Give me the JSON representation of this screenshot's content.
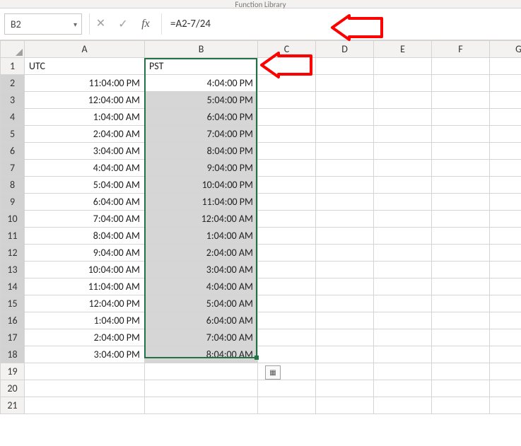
{
  "ribbon": {
    "group_label": "Function Library"
  },
  "namebox": {
    "value": "B2"
  },
  "formula": "=A2-7/24",
  "columns": [
    "A",
    "B",
    "C",
    "D",
    "E",
    "F",
    "G"
  ],
  "header": {
    "A": "UTC",
    "B": "PST"
  },
  "rows": [
    {
      "n": 2,
      "A": "11:04:00 PM",
      "B": "4:04:00 PM"
    },
    {
      "n": 3,
      "A": "12:04:00 AM",
      "B": "5:04:00 PM"
    },
    {
      "n": 4,
      "A": "1:04:00 AM",
      "B": "6:04:00 PM"
    },
    {
      "n": 5,
      "A": "2:04:00 AM",
      "B": "7:04:00 PM"
    },
    {
      "n": 6,
      "A": "3:04:00 AM",
      "B": "8:04:00 PM"
    },
    {
      "n": 7,
      "A": "4:04:00 AM",
      "B": "9:04:00 PM"
    },
    {
      "n": 8,
      "A": "5:04:00 AM",
      "B": "10:04:00 PM"
    },
    {
      "n": 9,
      "A": "6:04:00 AM",
      "B": "11:04:00 PM"
    },
    {
      "n": 10,
      "A": "7:04:00 AM",
      "B": "12:04:00 AM"
    },
    {
      "n": 11,
      "A": "8:04:00 AM",
      "B": "1:04:00 AM"
    },
    {
      "n": 12,
      "A": "9:04:00 AM",
      "B": "2:04:00 AM"
    },
    {
      "n": 13,
      "A": "10:04:00 AM",
      "B": "3:04:00 AM"
    },
    {
      "n": 14,
      "A": "11:04:00 AM",
      "B": "4:04:00 AM"
    },
    {
      "n": 15,
      "A": "12:04:00 PM",
      "B": "5:04:00 AM"
    },
    {
      "n": 16,
      "A": "1:04:00 PM",
      "B": "6:04:00 AM"
    },
    {
      "n": 17,
      "A": "2:04:00 PM",
      "B": "7:04:00 AM"
    },
    {
      "n": 18,
      "A": "3:04:00 PM",
      "B": "8:04:00 AM"
    }
  ],
  "blank_rows": [
    19,
    20,
    21
  ],
  "selection": {
    "range": "B2:B18",
    "active": "B2"
  }
}
